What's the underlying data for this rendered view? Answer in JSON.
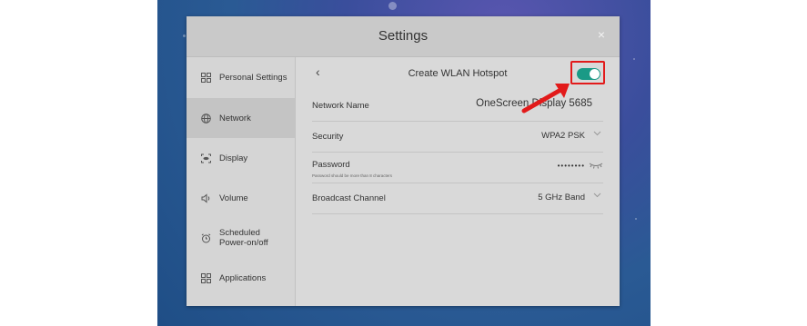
{
  "dialog": {
    "title": "Settings",
    "close_label": "×"
  },
  "sidebar": {
    "items": [
      {
        "label": "Personal Settings",
        "icon": "grid-icon",
        "active": false
      },
      {
        "label": "Network",
        "icon": "globe-icon",
        "active": true
      },
      {
        "label": "Display",
        "icon": "display-icon",
        "active": false
      },
      {
        "label": "Volume",
        "icon": "speaker-icon",
        "active": false
      },
      {
        "label": "Scheduled Power-on/off",
        "icon": "alarm-clock-icon",
        "active": false
      },
      {
        "label": "Applications",
        "icon": "grid-icon",
        "active": false
      }
    ]
  },
  "hotspot": {
    "back_label": "‹",
    "title": "Create WLAN Hotspot",
    "enabled": true,
    "rows": [
      {
        "label": "Network Name",
        "value": "OneScreen Display 5685"
      },
      {
        "label": "Security",
        "value": "WPA2 PSK"
      },
      {
        "label": "Password",
        "hint": "Password should be more than 8 characters",
        "value": "••••••••"
      },
      {
        "label": "Broadcast Channel",
        "value": "5 GHz Band"
      }
    ]
  },
  "colors": {
    "accent": "#1a9a86",
    "annotation": "#e21a1a"
  }
}
